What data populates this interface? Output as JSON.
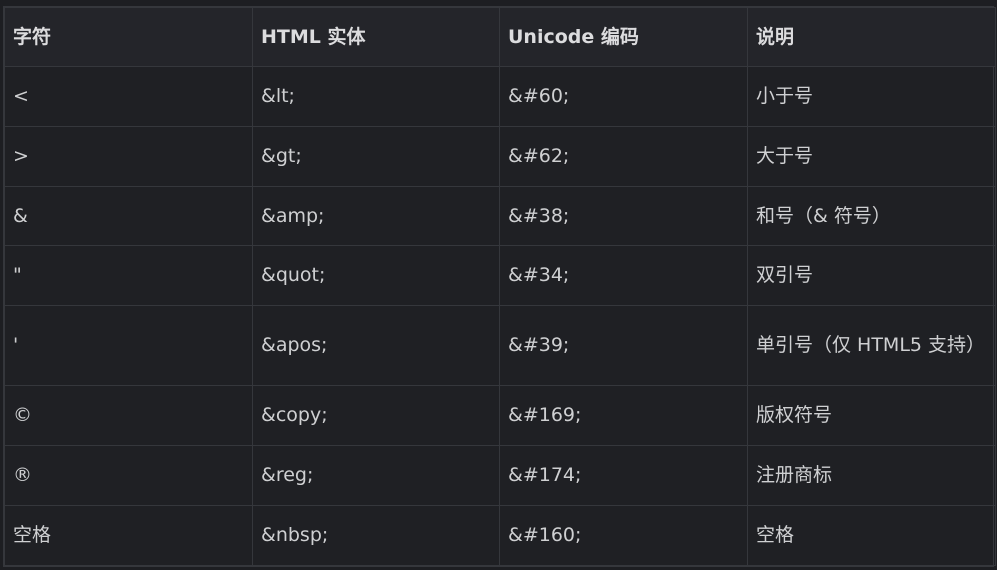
{
  "table": {
    "headers": [
      "字符",
      "HTML 实体",
      "Unicode 编码",
      "说明"
    ],
    "rows": [
      {
        "char": "<",
        "entity": "&lt;",
        "code": "&#60;",
        "desc": "小于号"
      },
      {
        "char": ">",
        "entity": "&gt;",
        "code": "&#62;",
        "desc": "大于号"
      },
      {
        "char": "&",
        "entity": "&amp;",
        "code": "&#38;",
        "desc": "和号（& 符号）"
      },
      {
        "char": "\"",
        "entity": "&quot;",
        "code": "&#34;",
        "desc": "双引号"
      },
      {
        "char": "'",
        "entity": "&apos;",
        "code": "&#39;",
        "desc": "单引号（仅 HTML5 支持）"
      },
      {
        "char": "©",
        "entity": "&copy;",
        "code": "&#169;",
        "desc": "版权符号"
      },
      {
        "char": "®",
        "entity": "&reg;",
        "code": "&#174;",
        "desc": "注册商标"
      },
      {
        "char": "空格",
        "entity": "&nbsp;",
        "code": "&#160;",
        "desc": "空格"
      }
    ]
  }
}
